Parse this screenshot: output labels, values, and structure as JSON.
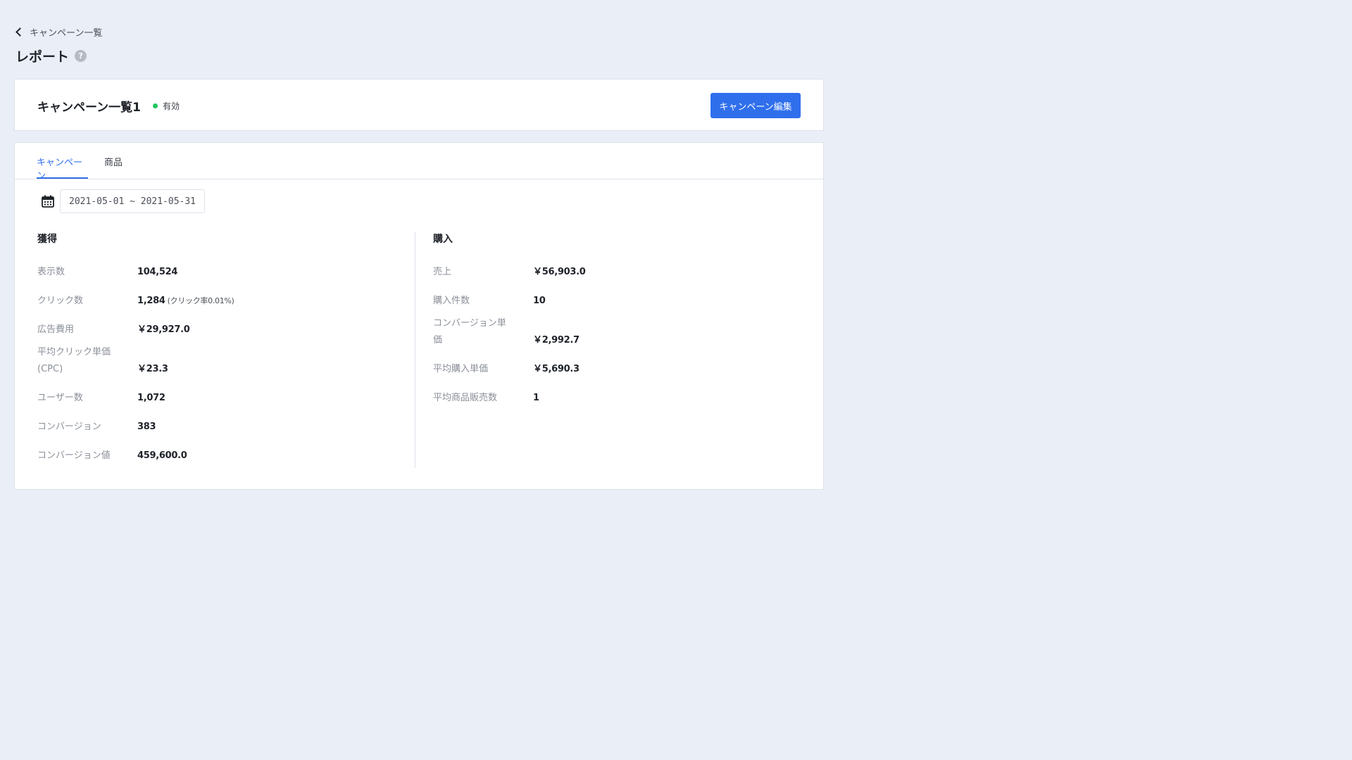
{
  "nav": {
    "back_label": "キャンペーン一覧"
  },
  "page": {
    "title": "レポート",
    "help_icon": "?"
  },
  "campaign": {
    "name": "キャンペーン一覧1",
    "status": "有効",
    "status_color": "#22c55e",
    "edit_button": "キャンペーン編集"
  },
  "tabs": [
    {
      "label": "キャンペーン",
      "active": true
    },
    {
      "label": "商品",
      "active": false
    }
  ],
  "date_range": "2021-05-01 ~ 2021-05-31",
  "acquisition": {
    "title": "獲得",
    "impressions": {
      "label": "表示数",
      "value": "104,524"
    },
    "clicks": {
      "label": "クリック数",
      "value": "1,284",
      "note": "(クリック率0.01%)"
    },
    "ad_cost": {
      "label": "広告費用",
      "value": "￥29,927.0"
    },
    "cpc": {
      "label_line1": "平均クリック単価",
      "label_line2": "(CPC)",
      "value": "￥23.3"
    },
    "users": {
      "label": "ユーザー数",
      "value": "1,072"
    },
    "conversions": {
      "label": "コンバージョン",
      "value": "383"
    },
    "conversion_value": {
      "label": "コンバージョン値",
      "value": "459,600.0"
    }
  },
  "purchase": {
    "title": "購入",
    "sales": {
      "label": "売上",
      "value": "￥56,903.0"
    },
    "purchase_count": {
      "label": "購入件数",
      "value": "10"
    },
    "cost_per_conversion": {
      "label_line1": "コンバージョン単",
      "label_line2": "価",
      "value": "￥2,992.7"
    },
    "avg_order_value": {
      "label": "平均購入単価",
      "value": "￥5,690.3"
    },
    "avg_items_sold": {
      "label": "平均商品販売数",
      "value": "1"
    }
  },
  "colors": {
    "accent": "#2f6fec",
    "background": "#eaeef6"
  }
}
